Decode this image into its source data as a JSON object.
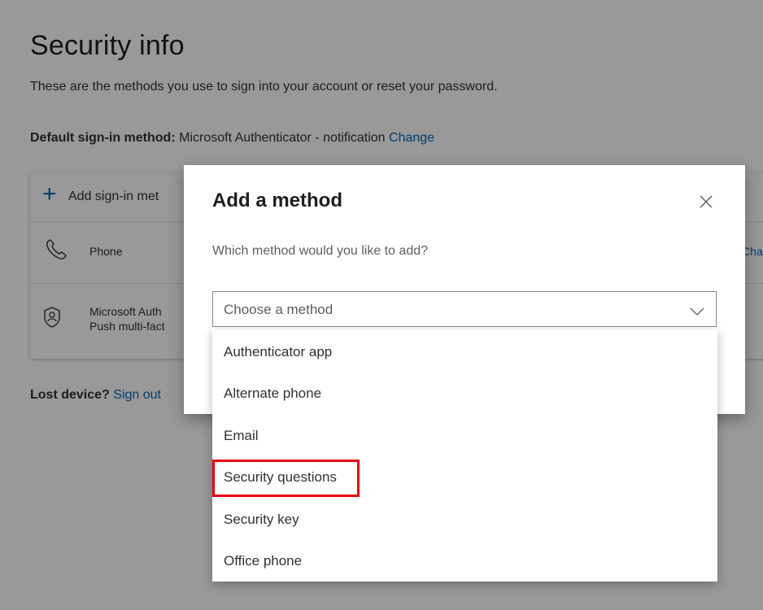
{
  "page": {
    "title": "Security info",
    "description": "These are the methods you use to sign into your account or reset your password.",
    "default_method_label": "Default sign-in method:",
    "default_method_value": "Microsoft Authenticator - notification",
    "default_method_change": "Change",
    "add_method_label": "Add sign-in met",
    "methods": [
      {
        "icon": "phone-icon",
        "label": "Phone",
        "action": "Cha"
      },
      {
        "icon": "authenticator-icon",
        "name": "Microsoft Auth",
        "subtitle": "Push multi-fact"
      }
    ],
    "lost_device_label": "Lost device?",
    "lost_device_link": "Sign out"
  },
  "dialog": {
    "title": "Add a method",
    "close_icon": "close-icon",
    "question": "Which method would you like to add?",
    "select_placeholder": "Choose a method",
    "select_icon": "chevron-down-icon",
    "options": [
      "Authenticator app",
      "Alternate phone",
      "Email",
      "Security questions",
      "Security key",
      "Office phone"
    ],
    "highlighted_option": "Security questions",
    "highlight_color": "#e60012"
  },
  "colors": {
    "link": "#0067b8",
    "overlay": "rgba(0,0,0,0.40)",
    "text": "#323130"
  }
}
